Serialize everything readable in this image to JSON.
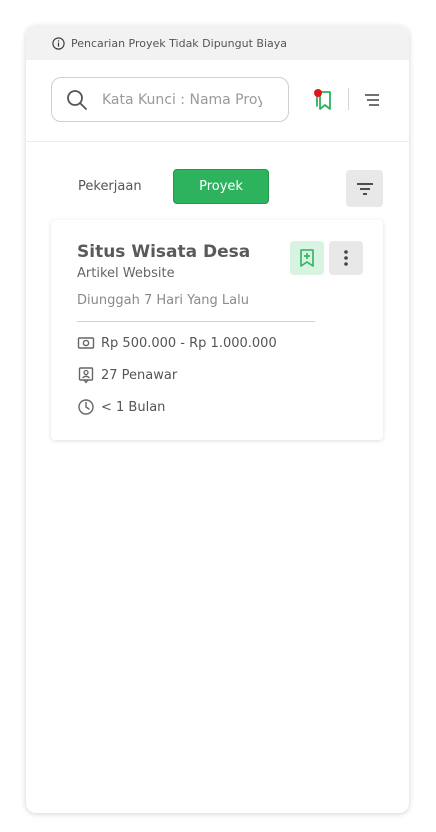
{
  "notice": {
    "icon": "info-icon",
    "text": "Pencarian Proyek Tidak Dipungut Biaya"
  },
  "header": {
    "search_placeholder": "Kata Kunci : Nama Proyek",
    "bookmark_icon": "bookmark-icon",
    "menu_icon": "menu-icon",
    "bookmark_badge_color": "#e0151b"
  },
  "tabs": {
    "items": [
      {
        "label": "Pekerjaan",
        "active": false
      },
      {
        "label": "Proyek",
        "active": true
      }
    ],
    "filter_icon": "filter-icon"
  },
  "projects": [
    {
      "title": "Situs Wisata Desa",
      "category": "Artikel Website",
      "posted": "Diunggah 7 Hari Yang Lalu",
      "budget": "Rp 500.000 - Rp 1.000.000",
      "bidders": "27 Penawar",
      "duration": "< 1 Bulan"
    }
  ],
  "colors": {
    "accent": "#2db35d",
    "accent_light": "#d9f3e2"
  }
}
